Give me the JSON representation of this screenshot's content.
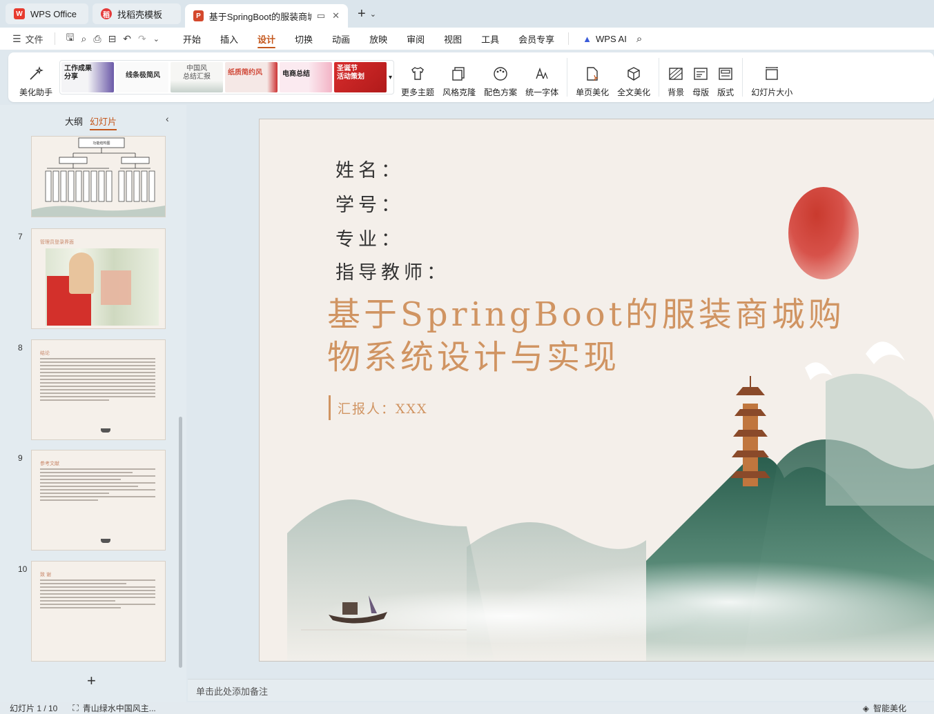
{
  "tabs": [
    {
      "label": "WPS Office",
      "logo": "W"
    },
    {
      "label": "找稻壳模板",
      "logo": "稻"
    },
    {
      "label": "基于SpringBoot的服装商城购",
      "logo": "P"
    }
  ],
  "menu": {
    "file": "文件",
    "items": [
      "开始",
      "插入",
      "设计",
      "切换",
      "动画",
      "放映",
      "审阅",
      "视图",
      "工具",
      "会员专享"
    ],
    "active": "设计",
    "wps_ai": "WPS AI"
  },
  "ribbon": {
    "beautify": "美化助手",
    "themes": [
      {
        "line1": "工作成果",
        "line2": "分享"
      },
      {
        "line1": "线条极简风",
        "line2": ""
      },
      {
        "line1": "中国风",
        "line2": "总结汇报"
      },
      {
        "line1": "纸质简约风",
        "line2": ""
      },
      {
        "line1": "电商总结",
        "line2": ""
      },
      {
        "line1": "圣诞节",
        "line2": "活动策划"
      }
    ],
    "more_themes": "更多主题",
    "style_clone": "风格克隆",
    "color_scheme": "配色方案",
    "unify_font": "统一字体",
    "single_page": "单页美化",
    "full_text": "全文美化",
    "background": "背景",
    "master": "母版",
    "layout": "版式",
    "slide_size": "幻灯片大小"
  },
  "left_panel": {
    "outline": "大纲",
    "slides": "幻灯片",
    "thumbs": [
      {
        "num": "",
        "title": "功能结构图"
      },
      {
        "num": "7",
        "title": "管理员登录界面"
      },
      {
        "num": "8",
        "title": "结论"
      },
      {
        "num": "9",
        "title": "参考文献"
      },
      {
        "num": "10",
        "title": "致 谢"
      }
    ]
  },
  "slide": {
    "name_label": "姓名：",
    "id_label": "学号：",
    "major_label": "专业：",
    "advisor_label": "指导教师：",
    "title_line1": "基于SpringBoot的服装商城购",
    "title_line2": "物系统设计与实现",
    "reporter": "汇报人：XXX"
  },
  "notes_placeholder": "单击此处添加备注",
  "status": {
    "slide_counter": "幻灯片 1 / 10",
    "theme_name": "青山绿水中国风主...",
    "smart_beautify": "智能美化"
  },
  "colors": {
    "accent": "#c4571c",
    "title": "#d09462",
    "sun": "#c93a2e",
    "mountain": "#2e6b5a"
  }
}
